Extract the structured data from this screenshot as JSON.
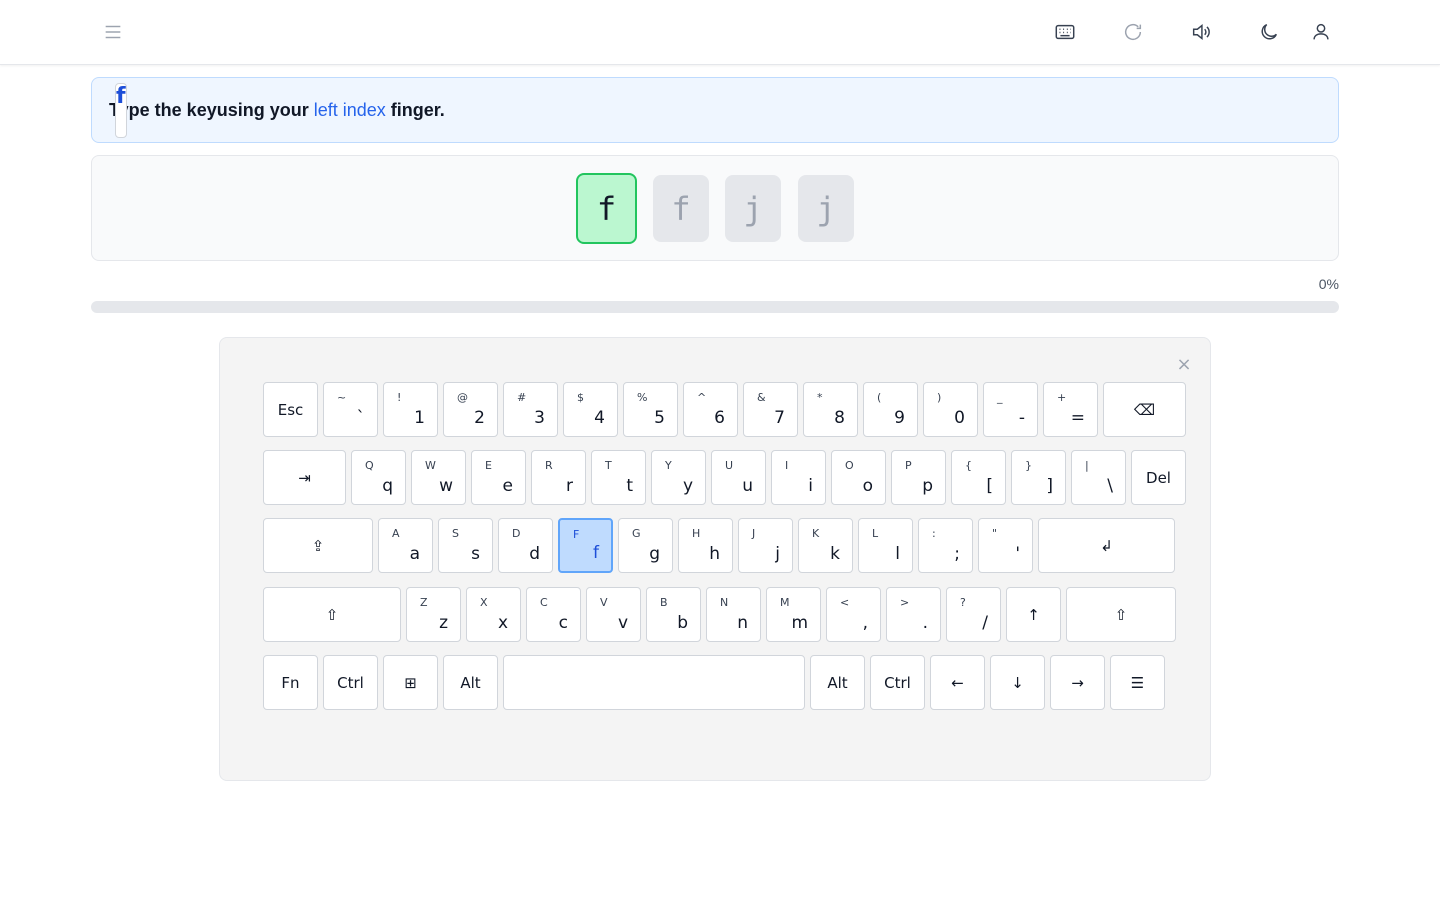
{
  "header": {
    "menu_icon": "hamburger-icon",
    "icons": [
      "keyboard-icon",
      "refresh-icon",
      "sound-icon",
      "moon-icon",
      "user-icon"
    ]
  },
  "instruction": {
    "prefix": "Type the key",
    "key": "f",
    "middle": "using your",
    "finger": "left index",
    "suffix": "finger."
  },
  "sequence": {
    "keys": [
      "f",
      "f",
      "j",
      "j"
    ],
    "active_index": 0
  },
  "progress": {
    "label": "0%",
    "value": 0
  },
  "keyboard": {
    "close_label": "×",
    "highlighted": "f",
    "rows": [
      [
        {
          "label": "Esc"
        },
        {
          "upper": "~",
          "lower": "`"
        },
        {
          "upper": "!",
          "lower": "1"
        },
        {
          "upper": "@",
          "lower": "2"
        },
        {
          "upper": "#",
          "lower": "3"
        },
        {
          "upper": "$",
          "lower": "4"
        },
        {
          "upper": "%",
          "lower": "5"
        },
        {
          "upper": "^",
          "lower": "6"
        },
        {
          "upper": "&",
          "lower": "7"
        },
        {
          "upper": "*",
          "lower": "8"
        },
        {
          "upper": "(",
          "lower": "9"
        },
        {
          "upper": ")",
          "lower": "0"
        },
        {
          "upper": "_",
          "lower": "-"
        },
        {
          "upper": "+",
          "lower": "="
        },
        {
          "label": "⌫"
        }
      ],
      [
        {
          "label": "⇥"
        },
        {
          "upper": "Q",
          "lower": "q"
        },
        {
          "upper": "W",
          "lower": "w"
        },
        {
          "upper": "E",
          "lower": "e"
        },
        {
          "upper": "R",
          "lower": "r"
        },
        {
          "upper": "T",
          "lower": "t"
        },
        {
          "upper": "Y",
          "lower": "y"
        },
        {
          "upper": "U",
          "lower": "u"
        },
        {
          "upper": "I",
          "lower": "i"
        },
        {
          "upper": "O",
          "lower": "o"
        },
        {
          "upper": "P",
          "lower": "p"
        },
        {
          "upper": "{",
          "lower": "["
        },
        {
          "upper": "}",
          "lower": "]"
        },
        {
          "upper": "|",
          "lower": "\\"
        },
        {
          "label": "Del"
        }
      ],
      [
        {
          "label": "⇪"
        },
        {
          "upper": "A",
          "lower": "a"
        },
        {
          "upper": "S",
          "lower": "s"
        },
        {
          "upper": "D",
          "lower": "d"
        },
        {
          "upper": "F",
          "lower": "f"
        },
        {
          "upper": "G",
          "lower": "g"
        },
        {
          "upper": "H",
          "lower": "h"
        },
        {
          "upper": "J",
          "lower": "j"
        },
        {
          "upper": "K",
          "lower": "k"
        },
        {
          "upper": "L",
          "lower": "l"
        },
        {
          "upper": ":",
          "lower": ";"
        },
        {
          "upper": "\"",
          "lower": "'"
        },
        {
          "label": "↲"
        }
      ],
      [
        {
          "label": "⇧"
        },
        {
          "upper": "Z",
          "lower": "z"
        },
        {
          "upper": "X",
          "lower": "x"
        },
        {
          "upper": "C",
          "lower": "c"
        },
        {
          "upper": "V",
          "lower": "v"
        },
        {
          "upper": "B",
          "lower": "b"
        },
        {
          "upper": "N",
          "lower": "n"
        },
        {
          "upper": "M",
          "lower": "m"
        },
        {
          "upper": "<",
          "lower": ","
        },
        {
          "upper": ">",
          "lower": "."
        },
        {
          "upper": "?",
          "lower": "/"
        },
        {
          "label": "↑"
        },
        {
          "label": "⇧"
        }
      ],
      [
        {
          "label": "Fn"
        },
        {
          "label": "Ctrl"
        },
        {
          "label": "⊞"
        },
        {
          "label": "Alt"
        },
        {
          "label": ""
        },
        {
          "label": "Alt"
        },
        {
          "label": "Ctrl"
        },
        {
          "label": "←"
        },
        {
          "label": "↓"
        },
        {
          "label": "→"
        },
        {
          "label": "☰"
        }
      ]
    ]
  }
}
